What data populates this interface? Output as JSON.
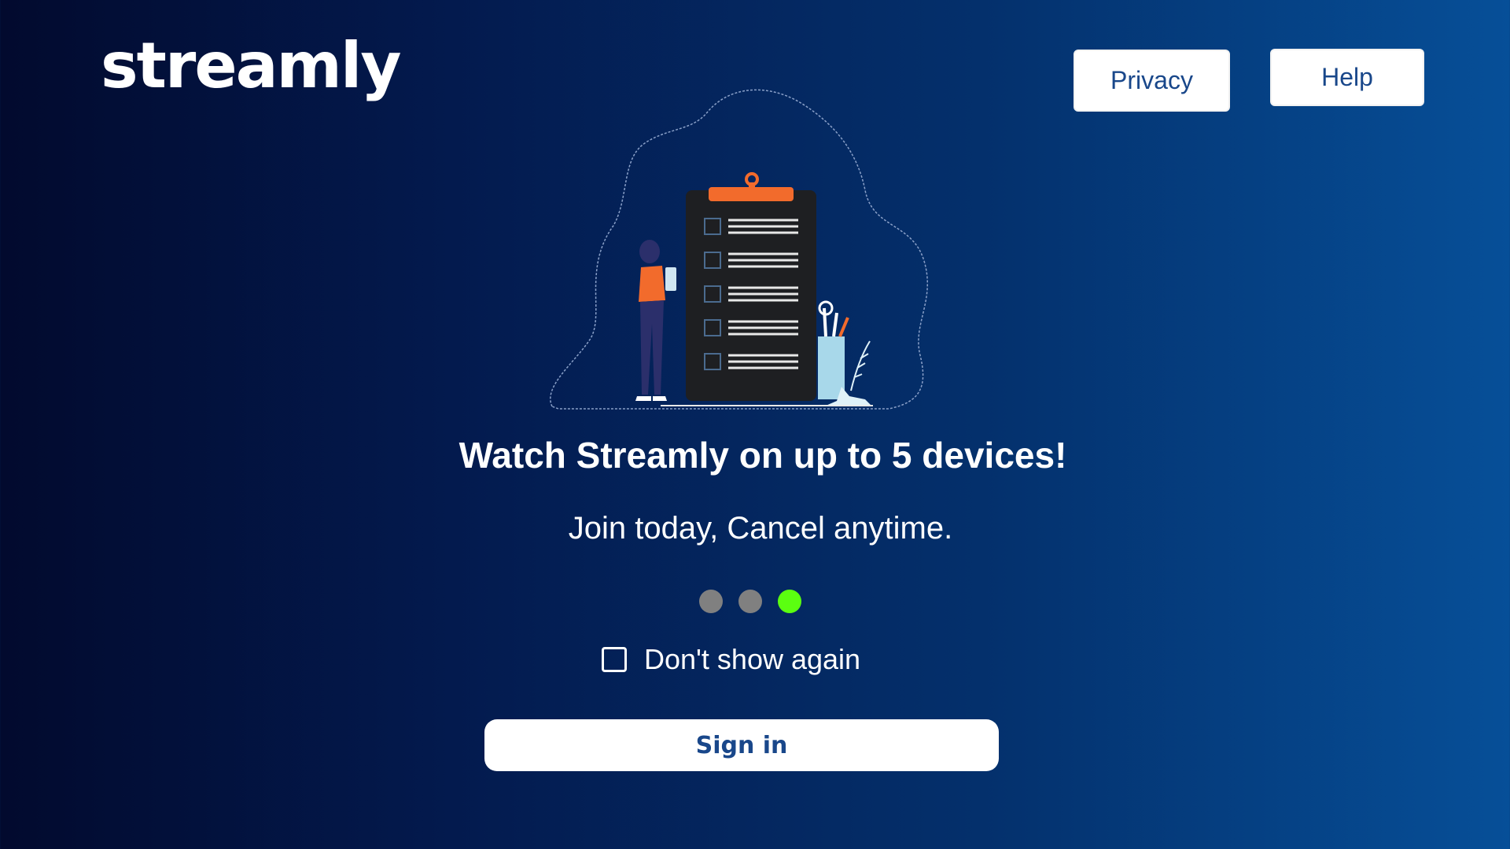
{
  "brand": {
    "logo_text": "streamly"
  },
  "header": {
    "privacy_label": "Privacy",
    "help_label": "Help"
  },
  "main": {
    "title": "Watch Streamly on up to 5 devices!",
    "subtitle": "Join today, Cancel anytime.",
    "pagination": {
      "total_pages": 3,
      "active_page": 3
    },
    "dont_show_label": "Don't show again",
    "dont_show_checked": false,
    "signin_label": "Sign in"
  },
  "colors": {
    "background_start": "#020a2e",
    "background_end": "#064f98",
    "button_text": "#19478a",
    "dot_inactive": "#808080",
    "dot_active": "#5bff10",
    "clipboard_accent": "#f26b2c"
  }
}
